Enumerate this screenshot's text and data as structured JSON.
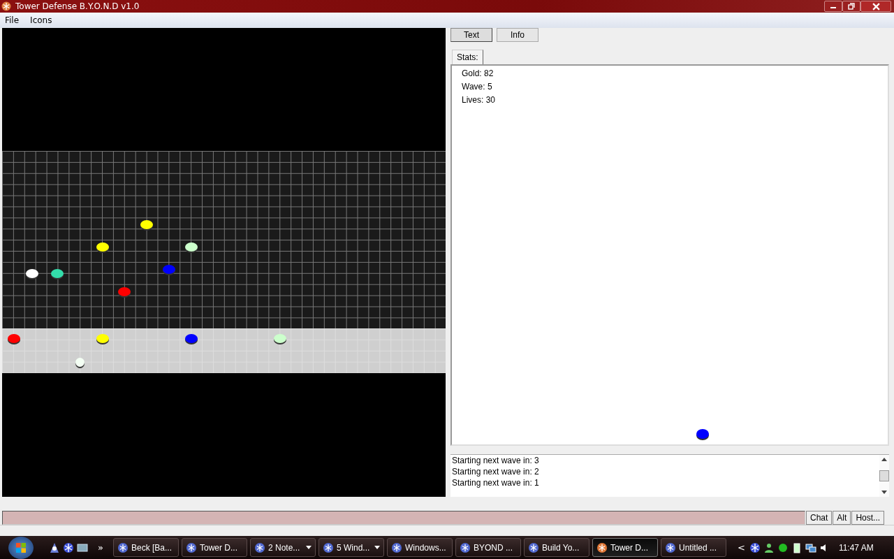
{
  "window": {
    "title": "Tower Defense B.Y.O.N.D v1.0"
  },
  "menu": [
    "File",
    "Icons"
  ],
  "map": {
    "units": [
      {
        "color": "#ffff00"
      },
      {
        "color": "#ffff00"
      },
      {
        "color": "#ccffcc"
      },
      {
        "color": "#ffffff"
      },
      {
        "color": "#33ddaa"
      },
      {
        "color": "#0000ff"
      },
      {
        "color": "#ff0000"
      },
      {
        "color": "#ff0000"
      },
      {
        "color": "#ffff00"
      },
      {
        "color": "#0000ff"
      },
      {
        "color": "#ccffcc"
      },
      {
        "color": "#f4fff4"
      }
    ]
  },
  "panel_tabs": [
    {
      "label": "Text",
      "selected": true
    },
    {
      "label": "Info",
      "selected": false
    }
  ],
  "stats_tab": {
    "label": "Stats:",
    "selected": true
  },
  "stats": [
    "Gold: 82",
    "Wave: 5",
    "Lives: 30"
  ],
  "stats_unit": {
    "color": "#0000ff"
  },
  "output": [
    "Starting next wave in: 3",
    "Starting next wave in: 2",
    "Starting next wave in: 1"
  ],
  "input_buttons": [
    "Chat",
    "Alt",
    "Host..."
  ],
  "taskbar": {
    "tasks": [
      {
        "label": "Beck [Ba...",
        "selected": false,
        "dropdown": false
      },
      {
        "label": "Tower D...",
        "selected": false,
        "dropdown": false
      },
      {
        "label": "2 Note...",
        "selected": false,
        "dropdown": true
      },
      {
        "label": "5 Wind...",
        "selected": false,
        "dropdown": true
      },
      {
        "label": "Windows...",
        "selected": false,
        "dropdown": false
      },
      {
        "label": "BYOND ...",
        "selected": false,
        "dropdown": false
      },
      {
        "label": "Build Yo...",
        "selected": false,
        "dropdown": false
      },
      {
        "label": "Tower D...",
        "selected": true,
        "dropdown": false
      },
      {
        "label": "Untitled ...",
        "selected": false,
        "dropdown": false
      }
    ],
    "overflow": "»",
    "tray_toggle": "<",
    "clock": "11:47 AM"
  }
}
